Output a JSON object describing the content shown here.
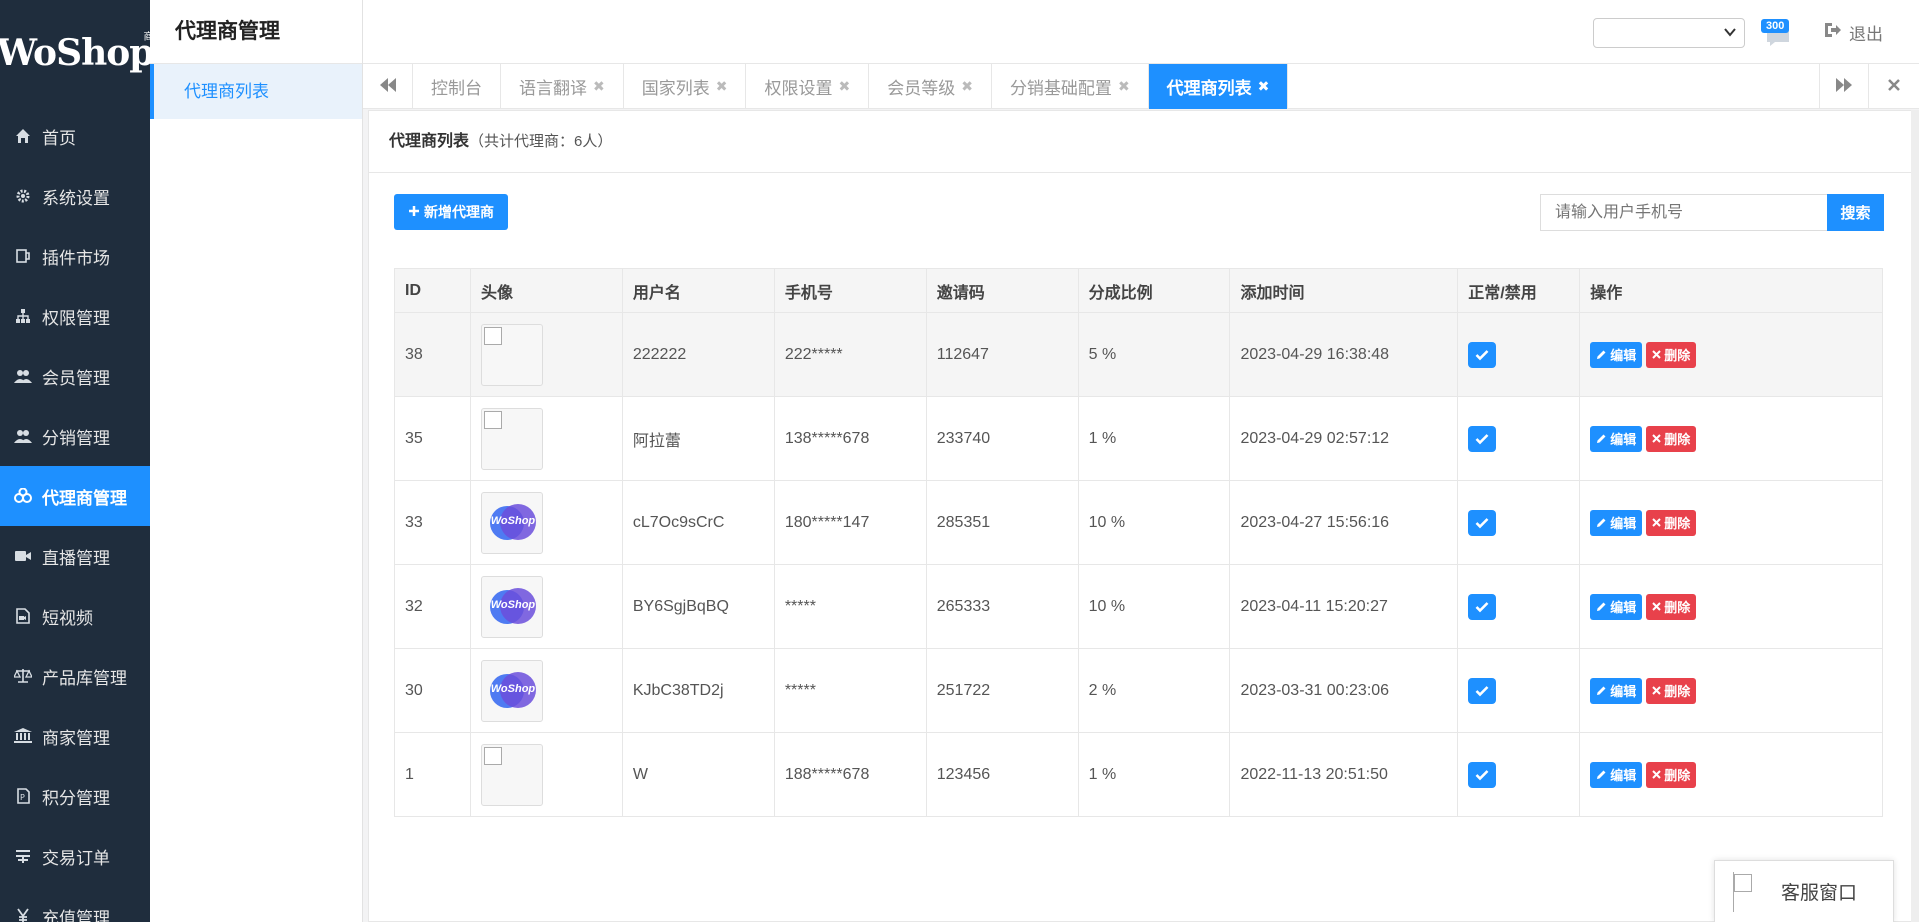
{
  "logo": {
    "text": "WoShop",
    "sub": "商城"
  },
  "sidebar": {
    "items": [
      {
        "label": "首页",
        "icon": "home-icon"
      },
      {
        "label": "系统设置",
        "icon": "gear-icon"
      },
      {
        "label": "插件市场",
        "icon": "plugin-icon"
      },
      {
        "label": "权限管理",
        "icon": "sitemap-icon"
      },
      {
        "label": "会员管理",
        "icon": "users-icon"
      },
      {
        "label": "分销管理",
        "icon": "users-icon"
      },
      {
        "label": "代理商管理",
        "icon": "agent-icon",
        "active": true
      },
      {
        "label": "直播管理",
        "icon": "video-icon"
      },
      {
        "label": "短视频",
        "icon": "file-video-icon"
      },
      {
        "label": "产品库管理",
        "icon": "balance-icon"
      },
      {
        "label": "商家管理",
        "icon": "bank-icon"
      },
      {
        "label": "积分管理",
        "icon": "points-icon"
      },
      {
        "label": "交易订单",
        "icon": "order-icon"
      },
      {
        "label": "充值管理",
        "icon": "yen-icon"
      }
    ]
  },
  "submenu": {
    "title": "代理商管理",
    "items": [
      {
        "label": "代理商列表"
      }
    ]
  },
  "topbar": {
    "lang_value": "",
    "badge": "300",
    "logout": "退出"
  },
  "tabs": [
    {
      "label": "控制台",
      "closable": false
    },
    {
      "label": "语言翻译",
      "closable": true
    },
    {
      "label": "国家列表",
      "closable": true
    },
    {
      "label": "权限设置",
      "closable": true
    },
    {
      "label": "会员等级",
      "closable": true
    },
    {
      "label": "分销基础配置",
      "closable": true
    },
    {
      "label": "代理商列表",
      "closable": true,
      "active": true
    }
  ],
  "panel": {
    "title": "代理商列表",
    "subtitle": "（共计代理商：6人）",
    "add_button": "新增代理商",
    "search_placeholder": "请输入用户手机号",
    "search_button": "搜索"
  },
  "table": {
    "headers": [
      "ID",
      "头像",
      "用户名",
      "手机号",
      "邀请码",
      "分成比例",
      "添加时间",
      "正常/禁用",
      "操作"
    ],
    "edit_label": "编辑",
    "delete_label": "删除",
    "rows": [
      {
        "id": "38",
        "avatar": "broken",
        "username": "222222",
        "phone": "222*****",
        "invite": "112647",
        "ratio": "5 %",
        "time": "2023-04-29 16:38:48",
        "enabled": true
      },
      {
        "id": "35",
        "avatar": "broken",
        "username": "阿拉蕾",
        "phone": "138*****678",
        "invite": "233740",
        "ratio": "1 %",
        "time": "2023-04-29 02:57:12",
        "enabled": true
      },
      {
        "id": "33",
        "avatar": "woshop",
        "username": "cL7Oc9sCrC",
        "phone": "180*****147",
        "invite": "285351",
        "ratio": "10 %",
        "time": "2023-04-27 15:56:16",
        "enabled": true
      },
      {
        "id": "32",
        "avatar": "woshop",
        "username": "BY6SgjBqBQ",
        "phone": "*****",
        "invite": "265333",
        "ratio": "10 %",
        "time": "2023-04-11 15:20:27",
        "enabled": true
      },
      {
        "id": "30",
        "avatar": "woshop",
        "username": "KJbC38TD2j",
        "phone": "*****",
        "invite": "251722",
        "ratio": "2 %",
        "time": "2023-03-31 00:23:06",
        "enabled": true
      },
      {
        "id": "1",
        "avatar": "broken",
        "username": "W",
        "phone": "188*****678",
        "invite": "123456",
        "ratio": "1 %",
        "time": "2022-11-13 20:51:50",
        "enabled": true
      }
    ]
  },
  "cs_float": {
    "label": "客服窗口"
  },
  "colors": {
    "sidebar_bg": "#1f2d3d",
    "accent": "#1e90ff",
    "danger": "#e8414b"
  }
}
